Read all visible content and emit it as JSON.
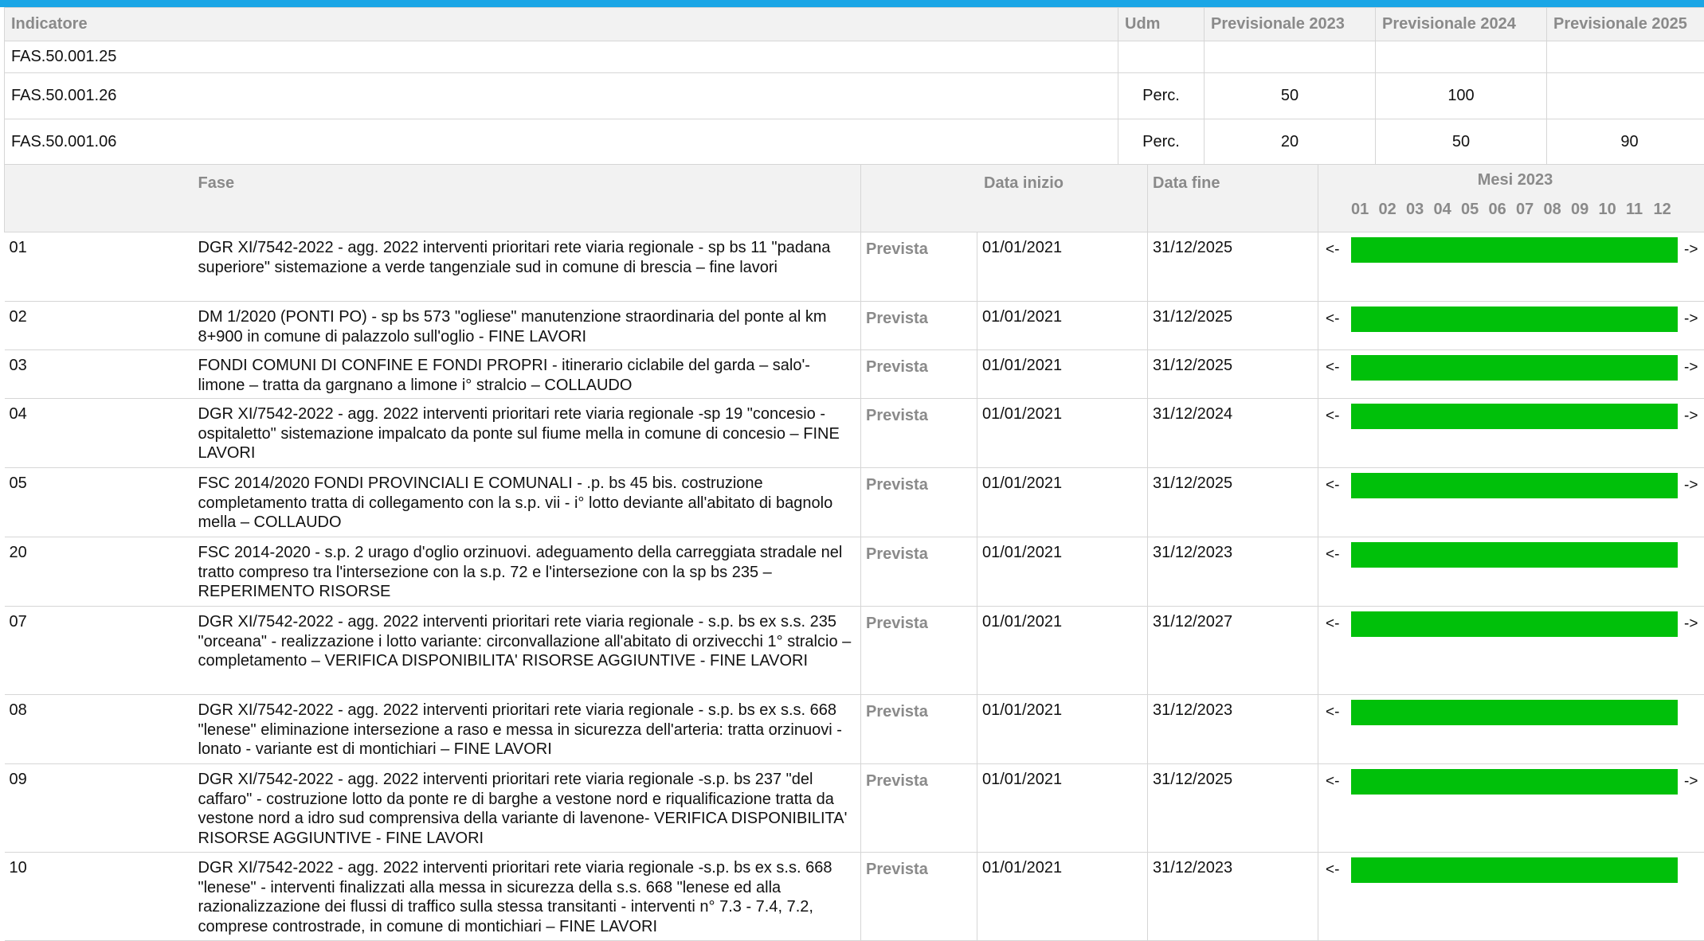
{
  "indicator_table": {
    "headers": [
      "Indicatore",
      "Udm",
      "Previsionale 2023",
      "Previsionale 2024",
      "Previsionale 2025"
    ],
    "rows": [
      {
        "code": "FAS.50.001.25",
        "udm": "",
        "p2023": "",
        "p2024": "",
        "p2025": ""
      },
      {
        "code": "FAS.50.001.26",
        "udm": "Perc.",
        "p2023": "50",
        "p2024": "100",
        "p2025": ""
      },
      {
        "code": "FAS.50.001.06",
        "udm": "Perc.",
        "p2023": "20",
        "p2024": "50",
        "p2025": "90"
      }
    ]
  },
  "phase_table": {
    "headers": {
      "fase": "Fase",
      "data_inizio": "Data inizio",
      "data_fine": "Data fine",
      "mesi": "Mesi 2023"
    },
    "months": [
      "01",
      "02",
      "03",
      "04",
      "05",
      "06",
      "07",
      "08",
      "09",
      "10",
      "11",
      "12"
    ],
    "arrow_left": "<-",
    "arrow_right": "->",
    "rows": [
      {
        "num": "01",
        "desc": "DGR XI/7542-2022 - agg. 2022 interventi prioritari rete viaria regionale  - sp bs  11 \"padana superiore\" sistemazione a verde tangenziale sud in comune di brescia – fine lavori",
        "stato": "Prevista",
        "inizio": "01/01/2021",
        "fine": "31/12/2025",
        "right_arrow": true
      },
      {
        "num": "02",
        "desc": "DM 1/2020 (PONTI PO)  - sp bs 573 \"ogliese\" manutenzione straordinaria del ponte al km 8+900 in comune di palazzolo sull'oglio  - FINE LAVORI",
        "stato": "Prevista",
        "inizio": "01/01/2021",
        "fine": "31/12/2025",
        "right_arrow": true
      },
      {
        "num": "03",
        "desc": "FONDI COMUNI DI CONFINE E FONDI PROPRI - itinerario ciclabile del garda – salo'-limone – tratta da gargnano a limone i° stralcio – COLLAUDO",
        "stato": "Prevista",
        "inizio": "01/01/2021",
        "fine": "31/12/2025",
        "right_arrow": true
      },
      {
        "num": "04",
        "desc": "DGR XI/7542-2022 - agg. 2022 interventi prioritari rete viaria regionale -sp 19 \"concesio - ospitaletto\" sistemazione impalcato da ponte sul fiume mella in comune di concesio – FINE LAVORI",
        "stato": "Prevista",
        "inizio": "01/01/2021",
        "fine": "31/12/2024",
        "right_arrow": true
      },
      {
        "num": "05",
        "desc": "FSC 2014/2020 FONDI PROVINCIALI E COMUNALI - .p. bs 45 bis. costruzione completamento tratta di collegamento con la  s.p. vii - i° lotto deviante all'abitato di bagnolo mella – COLLAUDO",
        "stato": "Prevista",
        "inizio": "01/01/2021",
        "fine": "31/12/2025",
        "right_arrow": true
      },
      {
        "num": "20",
        "desc": "FSC 2014-2020  - s.p. 2 urago d'oglio orzinuovi. adeguamento della carreggiata stradale nel tratto compreso tra l'intersezione con la s.p.  72 e l'intersezione con la sp bs 235 – REPERIMENTO RISORSE",
        "stato": "Prevista",
        "inizio": "01/01/2021",
        "fine": "31/12/2023",
        "right_arrow": false
      },
      {
        "num": "07",
        "desc": "DGR XI/7542-2022 - agg. 2022 interventi prioritari rete viaria regionale   - s.p. bs ex s.s. 235 \"orceana\" - realizzazione i lotto variante: circonvallazione all'abitato di orzivecchi 1° stralcio – completamento – VERIFICA DISPONIBILITA' RISORSE AGGIUNTIVE  - FINE LAVORI",
        "stato": "Prevista",
        "inizio": "01/01/2021",
        "fine": "31/12/2027",
        "right_arrow": true
      },
      {
        "num": "08",
        "desc": "DGR XI/7542-2022 - agg. 2022 interventi prioritari rete viaria regionale   - s.p. bs ex s.s. 668 \"lenese\" eliminazione intersezione a raso e messa in sicurezza dell'arteria: tratta orzinuovi - lonato - variante est di montichiari – FINE LAVORI",
        "stato": "Prevista",
        "inizio": "01/01/2021",
        "fine": "31/12/2023",
        "right_arrow": false
      },
      {
        "num": "09",
        "desc": "DGR XI/7542-2022 - agg. 2022 interventi prioritari rete viaria regionale  -s.p. bs 237 \"del caffaro\" -  costruzione lotto da ponte re di barghe a vestone nord e riqualificazione tratta da vestone nord a idro sud comprensiva della variante di lavenone- VERIFICA DISPONIBILITA' RISORSE AGGIUNTIVE  - FINE LAVORI",
        "stato": "Prevista",
        "inizio": "01/01/2021",
        "fine": "31/12/2025",
        "right_arrow": true
      },
      {
        "num": "10",
        "desc": "DGR XI/7542-2022 - agg. 2022 interventi prioritari rete viaria regionale -s.p. bs ex s.s. 668 \"lenese\" - interventi finalizzati alla messa in sicurezza della s.s. 668 \"lenese ed alla razionalizzazione dei flussi di traffico sulla stessa transitanti -  interventi n° 7.3 - 7.4, 7.2, comprese controstrade,  in comune di montichiari – FINE LAVORI",
        "stato": "Prevista",
        "inizio": "01/01/2021",
        "fine": "31/12/2023",
        "right_arrow": false
      }
    ]
  },
  "colors": {
    "top_bar": "#1aa6e6",
    "gantt_bar": "#00c00a",
    "header_text": "#8a8a8a"
  }
}
